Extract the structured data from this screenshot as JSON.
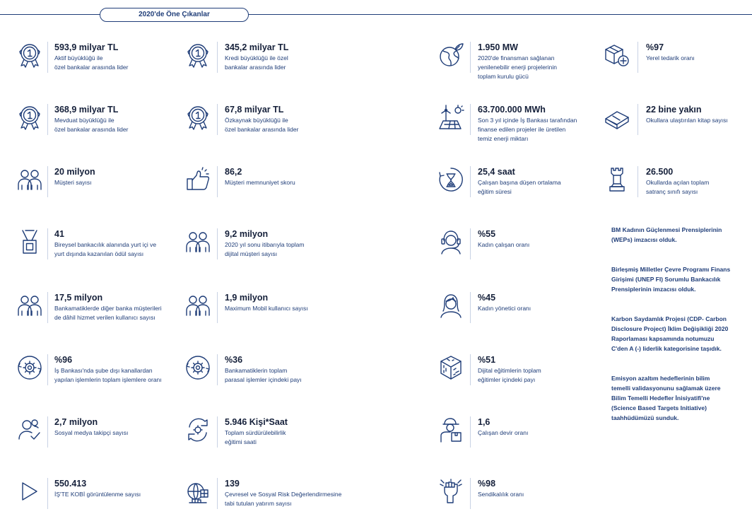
{
  "header": {
    "title": "2020'de Öne Çıkanlar"
  },
  "col1": [
    {
      "icon": "medal-icon",
      "value": "593,9 milyar TL",
      "desc": [
        "Aktif büyüklüğü ile",
        "özel bankalar arasında lider"
      ]
    },
    {
      "icon": "medal-icon",
      "value": "368,9 milyar TL",
      "desc": [
        "Mevduat büyüklüğü ile",
        "özel bankalar arasında lider"
      ]
    },
    {
      "icon": "people-group-icon",
      "value": "20 milyon",
      "desc": [
        "Müşteri sayısı"
      ]
    },
    {
      "icon": "award-medal-icon",
      "value": "41",
      "desc": [
        "Bireysel bankacılık alanında yurt içi ve",
        "yurt dışında kazanılan ödül sayısı"
      ]
    },
    {
      "icon": "people-group-icon",
      "value": "17,5 milyon",
      "desc": [
        "Bankamatiklerde diğer banka müşterileri",
        "de dâhil hizmet verilen kullanıcı sayısı"
      ]
    },
    {
      "icon": "gear-cycle-icon",
      "value": "%96",
      "desc": [
        "İş Bankası'nda şube dışı kanallardan",
        "yapılan işlemlerin toplam işlemlere oranı"
      ]
    },
    {
      "icon": "social-users-icon",
      "value": "2,7 milyon",
      "desc": [
        "Sosyal medya takipçi sayısı"
      ]
    },
    {
      "icon": "play-icon",
      "value": "550.413",
      "desc": [
        "İŞ'TE KOBİ görüntülenme sayısı"
      ]
    }
  ],
  "col2": [
    {
      "icon": "medal-icon",
      "value": "345,2 milyar TL",
      "desc": [
        "Kredi büyüklüğü ile özel",
        "bankalar arasında lider"
      ]
    },
    {
      "icon": "medal-icon",
      "value": "67,8 milyar TL",
      "desc": [
        "Özkaynak büyüklüğü ile",
        "özel bankalar arasında lider"
      ]
    },
    {
      "icon": "thumbs-up-icon",
      "value": "86,2",
      "desc": [
        "Müşteri memnuniyet skoru"
      ]
    },
    {
      "icon": "people-group-icon",
      "value": "9,2 milyon",
      "desc": [
        "2020 yıl sonu itibarıyla toplam",
        "dijital müşteri sayısı"
      ]
    },
    {
      "icon": "people-group-icon",
      "value": "1,9 milyon",
      "desc": [
        "Maximum Mobil kullanıcı sayısı"
      ]
    },
    {
      "icon": "gear-cycle-icon",
      "value": "%36",
      "desc": [
        "Bankamatiklerin toplam",
        "parasal işlemler içindeki payı"
      ]
    },
    {
      "icon": "recycle-arrows-icon",
      "value": "5.946 Kişi*Saat",
      "desc": [
        "Toplam sürdürülebilirlik",
        "eğitimi saati"
      ]
    },
    {
      "icon": "city-risk-icon",
      "value": "139",
      "desc": [
        "Çevresel ve Sosyal Risk Değerlendirmesine",
        "tabi tutulan yatırım sayısı"
      ]
    }
  ],
  "col3": [
    {
      "icon": "globe-leaf-icon",
      "value": "1.950 MW",
      "desc": [
        "2020'de finansman sağlanan",
        "yenilenebilir enerji projelerinin",
        "toplam kurulu gücü"
      ]
    },
    {
      "icon": "wind-solar-icon",
      "value": "63.700.000 MWh",
      "desc": [
        "Son 3 yıl içinde İş Bankası tarafından",
        "finanse edilen projeler ile üretilen",
        "temiz enerji miktarı"
      ]
    },
    {
      "icon": "hourglass-icon",
      "value": "25,4 saat",
      "desc": [
        "Çalışan başına düşen ortalama",
        "eğitim süresi"
      ]
    },
    {
      "icon": "woman-headset-icon",
      "value": "%55",
      "desc": [
        "Kadın çalışan oranı"
      ]
    },
    {
      "icon": "woman-icon",
      "value": "%45",
      "desc": [
        "Kadın yönetici oranı"
      ]
    },
    {
      "icon": "digital-cube-icon",
      "value": "%51",
      "desc": [
        " Dijital eğitimlerin toplam",
        "eğitimler içindeki payı"
      ]
    },
    {
      "icon": "delivery-worker-icon",
      "value": "1,6",
      "desc": [
        "Çalışan devir oranı"
      ]
    },
    {
      "icon": "union-fist-icon",
      "value": "%98",
      "desc": [
        "Sendikalılık oranı"
      ]
    }
  ],
  "col4": [
    {
      "icon": "boxes-plus-icon",
      "value": "%97",
      "desc": [
        "Yerel tedarik oranı"
      ]
    },
    {
      "icon": "book-icon",
      "value": "22 bine yakın",
      "desc": [
        "Okullara ulaştırılan kitap sayısı"
      ]
    },
    {
      "icon": "chess-rook-icon",
      "value": "26.500",
      "desc": [
        "Okullarda açılan toplam",
        "satranç sınıfı sayısı"
      ]
    }
  ],
  "notes": [
    [
      "BM Kadının Güçlenmesi Prensiplerinin",
      "(WEPs)  imzacısı olduk."
    ],
    [
      "Birleşmiş Milletler Çevre Programı Finans",
      "Girişimi (UNEP FI) Sorumlu Bankacılık",
      "Prensiplerinin imzacısı olduk."
    ],
    [
      "Karbon Saydamlık Projesi (CDP- Carbon",
      "Disclosure Project) İklim Değişikliği 2020",
      "Raporlaması kapsamında notumuzu",
      "C'den A (-) liderlik kategorisine taşıdık."
    ],
    [
      "Emisyon azaltım hedeflerinin bilim",
      "temelli validasyonunu sağlamak üzere",
      "Bilim Temelli Hedefler İnisiyatifi'ne",
      "(Science Based Targets Initiative)",
      "taahhüdümüzü sunduk."
    ]
  ],
  "colors": {
    "primary": "#1f3d78",
    "value_text": "#15203a",
    "divider": "#c8d2e4"
  }
}
